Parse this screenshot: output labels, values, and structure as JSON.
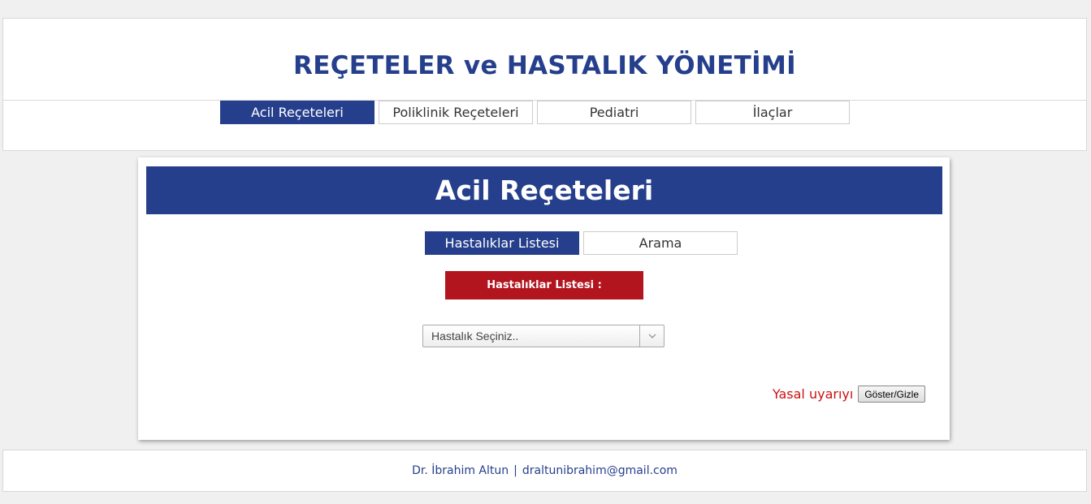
{
  "header": {
    "title": "REÇETELER ve HASTALIK YÖNETİMİ"
  },
  "nav": {
    "tabs": [
      {
        "label": "Acil Reçeteleri",
        "active": true
      },
      {
        "label": "Poliklinik Reçeteleri",
        "active": false
      },
      {
        "label": "Pediatri",
        "active": false
      },
      {
        "label": "İlaçlar",
        "active": false
      }
    ]
  },
  "main": {
    "banner_title": "Acil Reçeteleri",
    "sub_tabs": [
      {
        "label": "Hastalıklar Listesi",
        "active": true
      },
      {
        "label": "Arama",
        "active": false
      }
    ],
    "section_label": "Hastalıklar Listesi :",
    "disease_select": {
      "selected": "Hastalık Seçiniz.."
    },
    "legal": {
      "text": "Yasal uyarıyı",
      "button_label": "Göster/Gizle"
    }
  },
  "footer": {
    "author": "Dr. İbrahim Altun",
    "separator": "|",
    "email": "draltunibrahim@gmail.com"
  },
  "colors": {
    "brand_blue": "#263f8c",
    "section_red": "#b3151f",
    "legal_red": "#cc1111"
  },
  "icons": {
    "select_arrow": "chevron-down-icon"
  }
}
